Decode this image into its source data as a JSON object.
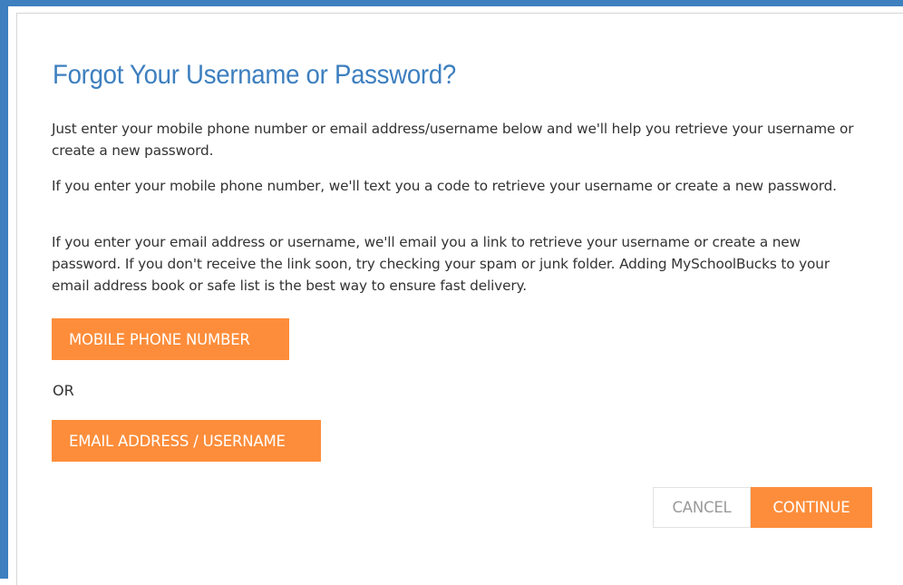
{
  "dialog": {
    "title": "Forgot Your Username or Password?",
    "paragraphs": [
      "Just enter your mobile phone number or email address/username below and we'll help you retrieve your username or create a new password.",
      "If you enter your mobile phone number, we'll text you a code to retrieve your username or create a new password.",
      "If you enter your email address or username, we'll email you a link to retrieve your username or create a new password. If you don't receive the link soon, try checking your spam or junk folder. Adding MySchoolBucks to your email address book or safe list is the best way to ensure fast delivery."
    ],
    "options": {
      "mobile_label": "MOBILE PHONE NUMBER",
      "or_label": "OR",
      "email_label": "EMAIL ADDRESS / USERNAME"
    },
    "actions": {
      "cancel_label": "CANCEL",
      "continue_label": "CONTINUE"
    }
  },
  "colors": {
    "accent_blue": "#3d7fbf",
    "accent_orange": "#fd8d3a",
    "body_text": "#333333",
    "muted_text": "#9a9a9a"
  }
}
